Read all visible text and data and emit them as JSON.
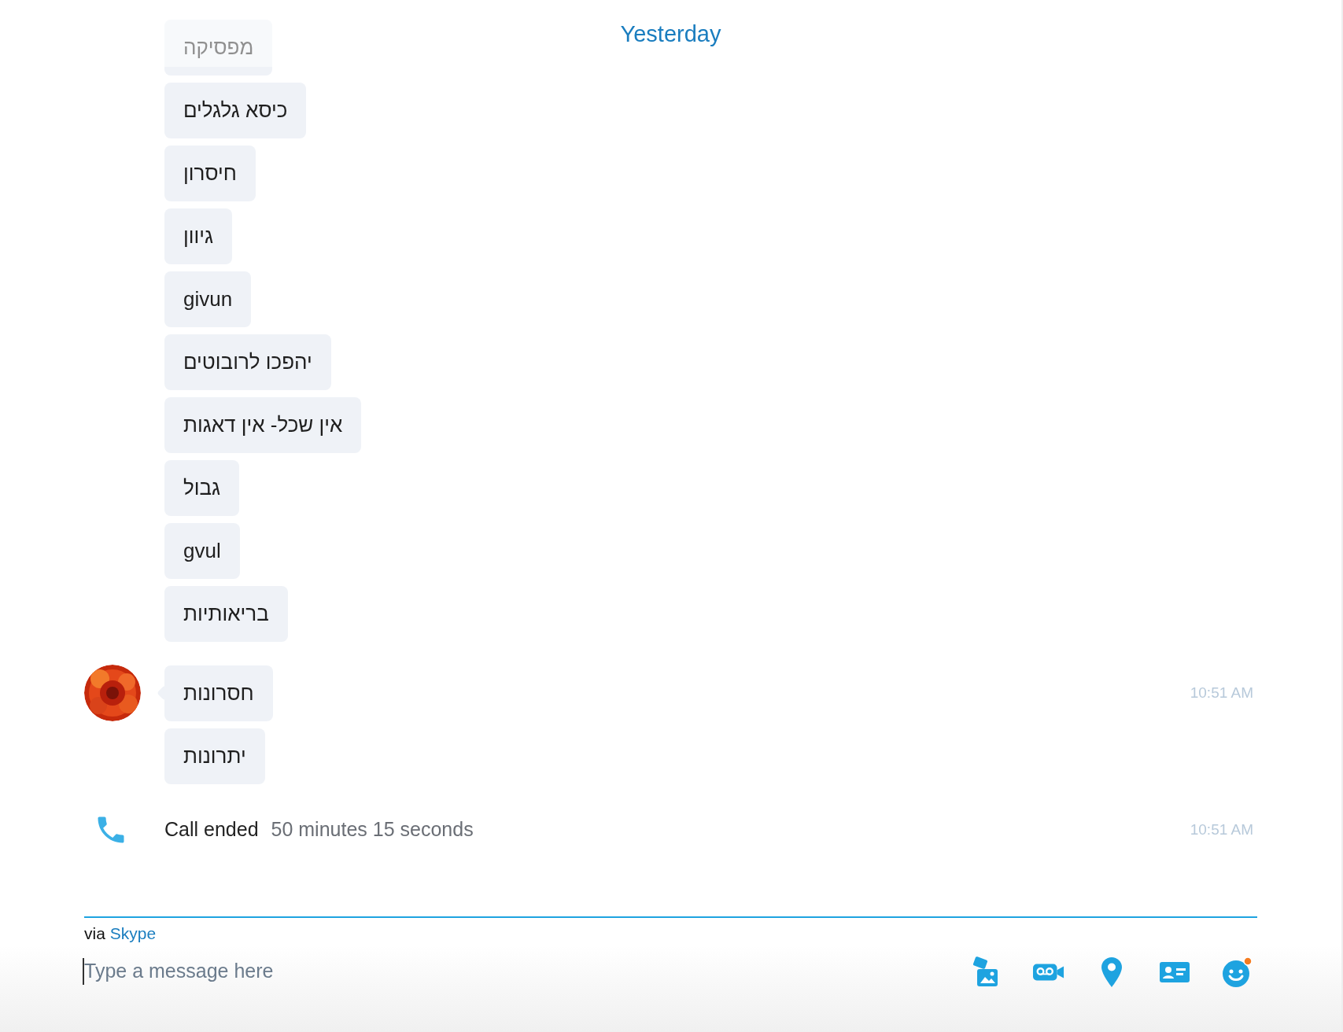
{
  "header": {
    "date": "Yesterday"
  },
  "messages": [
    {
      "text": "מפסיקה",
      "avatar": false
    },
    {
      "text": "כיסא גלגלים",
      "avatar": false
    },
    {
      "text": "חיסרון",
      "avatar": false
    },
    {
      "text": "גיוון",
      "avatar": false
    },
    {
      "text": "givun",
      "avatar": false
    },
    {
      "text": "יהפכו לרובוטים",
      "avatar": false
    },
    {
      "text": "אין שכל- אין דאגות",
      "avatar": false
    },
    {
      "text": "גבול",
      "avatar": false
    },
    {
      "text": "gvul",
      "avatar": false
    },
    {
      "text": "בריאותיות",
      "avatar": false
    },
    {
      "text": "חסרונות",
      "avatar": true,
      "time": "10:51 AM"
    },
    {
      "text": "יתרונות",
      "avatar": false
    }
  ],
  "call": {
    "label": "Call ended",
    "duration": "50 minutes 15 seconds",
    "time": "10:51 AM"
  },
  "composer": {
    "via": "via",
    "service": "Skype",
    "placeholder": "Type a message here"
  }
}
